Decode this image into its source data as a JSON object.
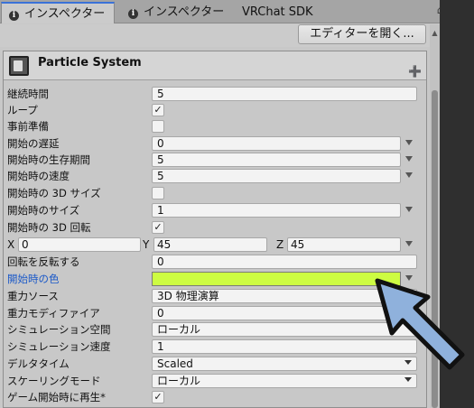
{
  "tabs": [
    {
      "label": "インスペクター",
      "icon": "info-icon",
      "active": true
    },
    {
      "label": "インスペクター",
      "icon": "info-icon",
      "active": false
    },
    {
      "label": "VRChat SDK",
      "active": false
    }
  ],
  "header_button": "エディターを開く...",
  "component": {
    "title": "Particle System",
    "icon": "particle-system-icon"
  },
  "rows": [
    {
      "label": "継続時間",
      "value": "5"
    },
    {
      "label": "ループ",
      "checked": true
    },
    {
      "label": "事前準備",
      "checked": false
    },
    {
      "label": "開始の遅延",
      "value": "0"
    },
    {
      "label": "開始時の生存期間",
      "value": "5"
    },
    {
      "label": "開始時の速度",
      "value": "5"
    },
    {
      "label": "開始時の 3D サイズ",
      "checked": false
    },
    {
      "label": "開始時のサイズ",
      "value": "1"
    },
    {
      "label": "開始時の 3D 回転",
      "checked": true
    },
    {
      "x_label": "X",
      "x": "0",
      "y_label": "Y",
      "y": "45",
      "z_label": "Z",
      "z": "45"
    },
    {
      "label": "回転を反転する",
      "value": "0"
    },
    {
      "label": "開始時の色",
      "color": "#cdfc42",
      "highlighted": true
    },
    {
      "label": "重力ソース",
      "value": "3D 物理演算"
    },
    {
      "label": "重力モディファイア",
      "value": "0"
    },
    {
      "label": "シミュレーション空間",
      "value": "ローカル"
    },
    {
      "label": "シミュレーション速度",
      "value": "1"
    },
    {
      "label": "デルタタイム",
      "value": "Scaled"
    },
    {
      "label": "スケーリングモード",
      "value": "ローカル"
    },
    {
      "label": "ゲーム開始時に再生*",
      "checked": true
    }
  ],
  "pointer": {
    "color": "#8fb1dc",
    "icon": "pointer-arrow-icon"
  }
}
